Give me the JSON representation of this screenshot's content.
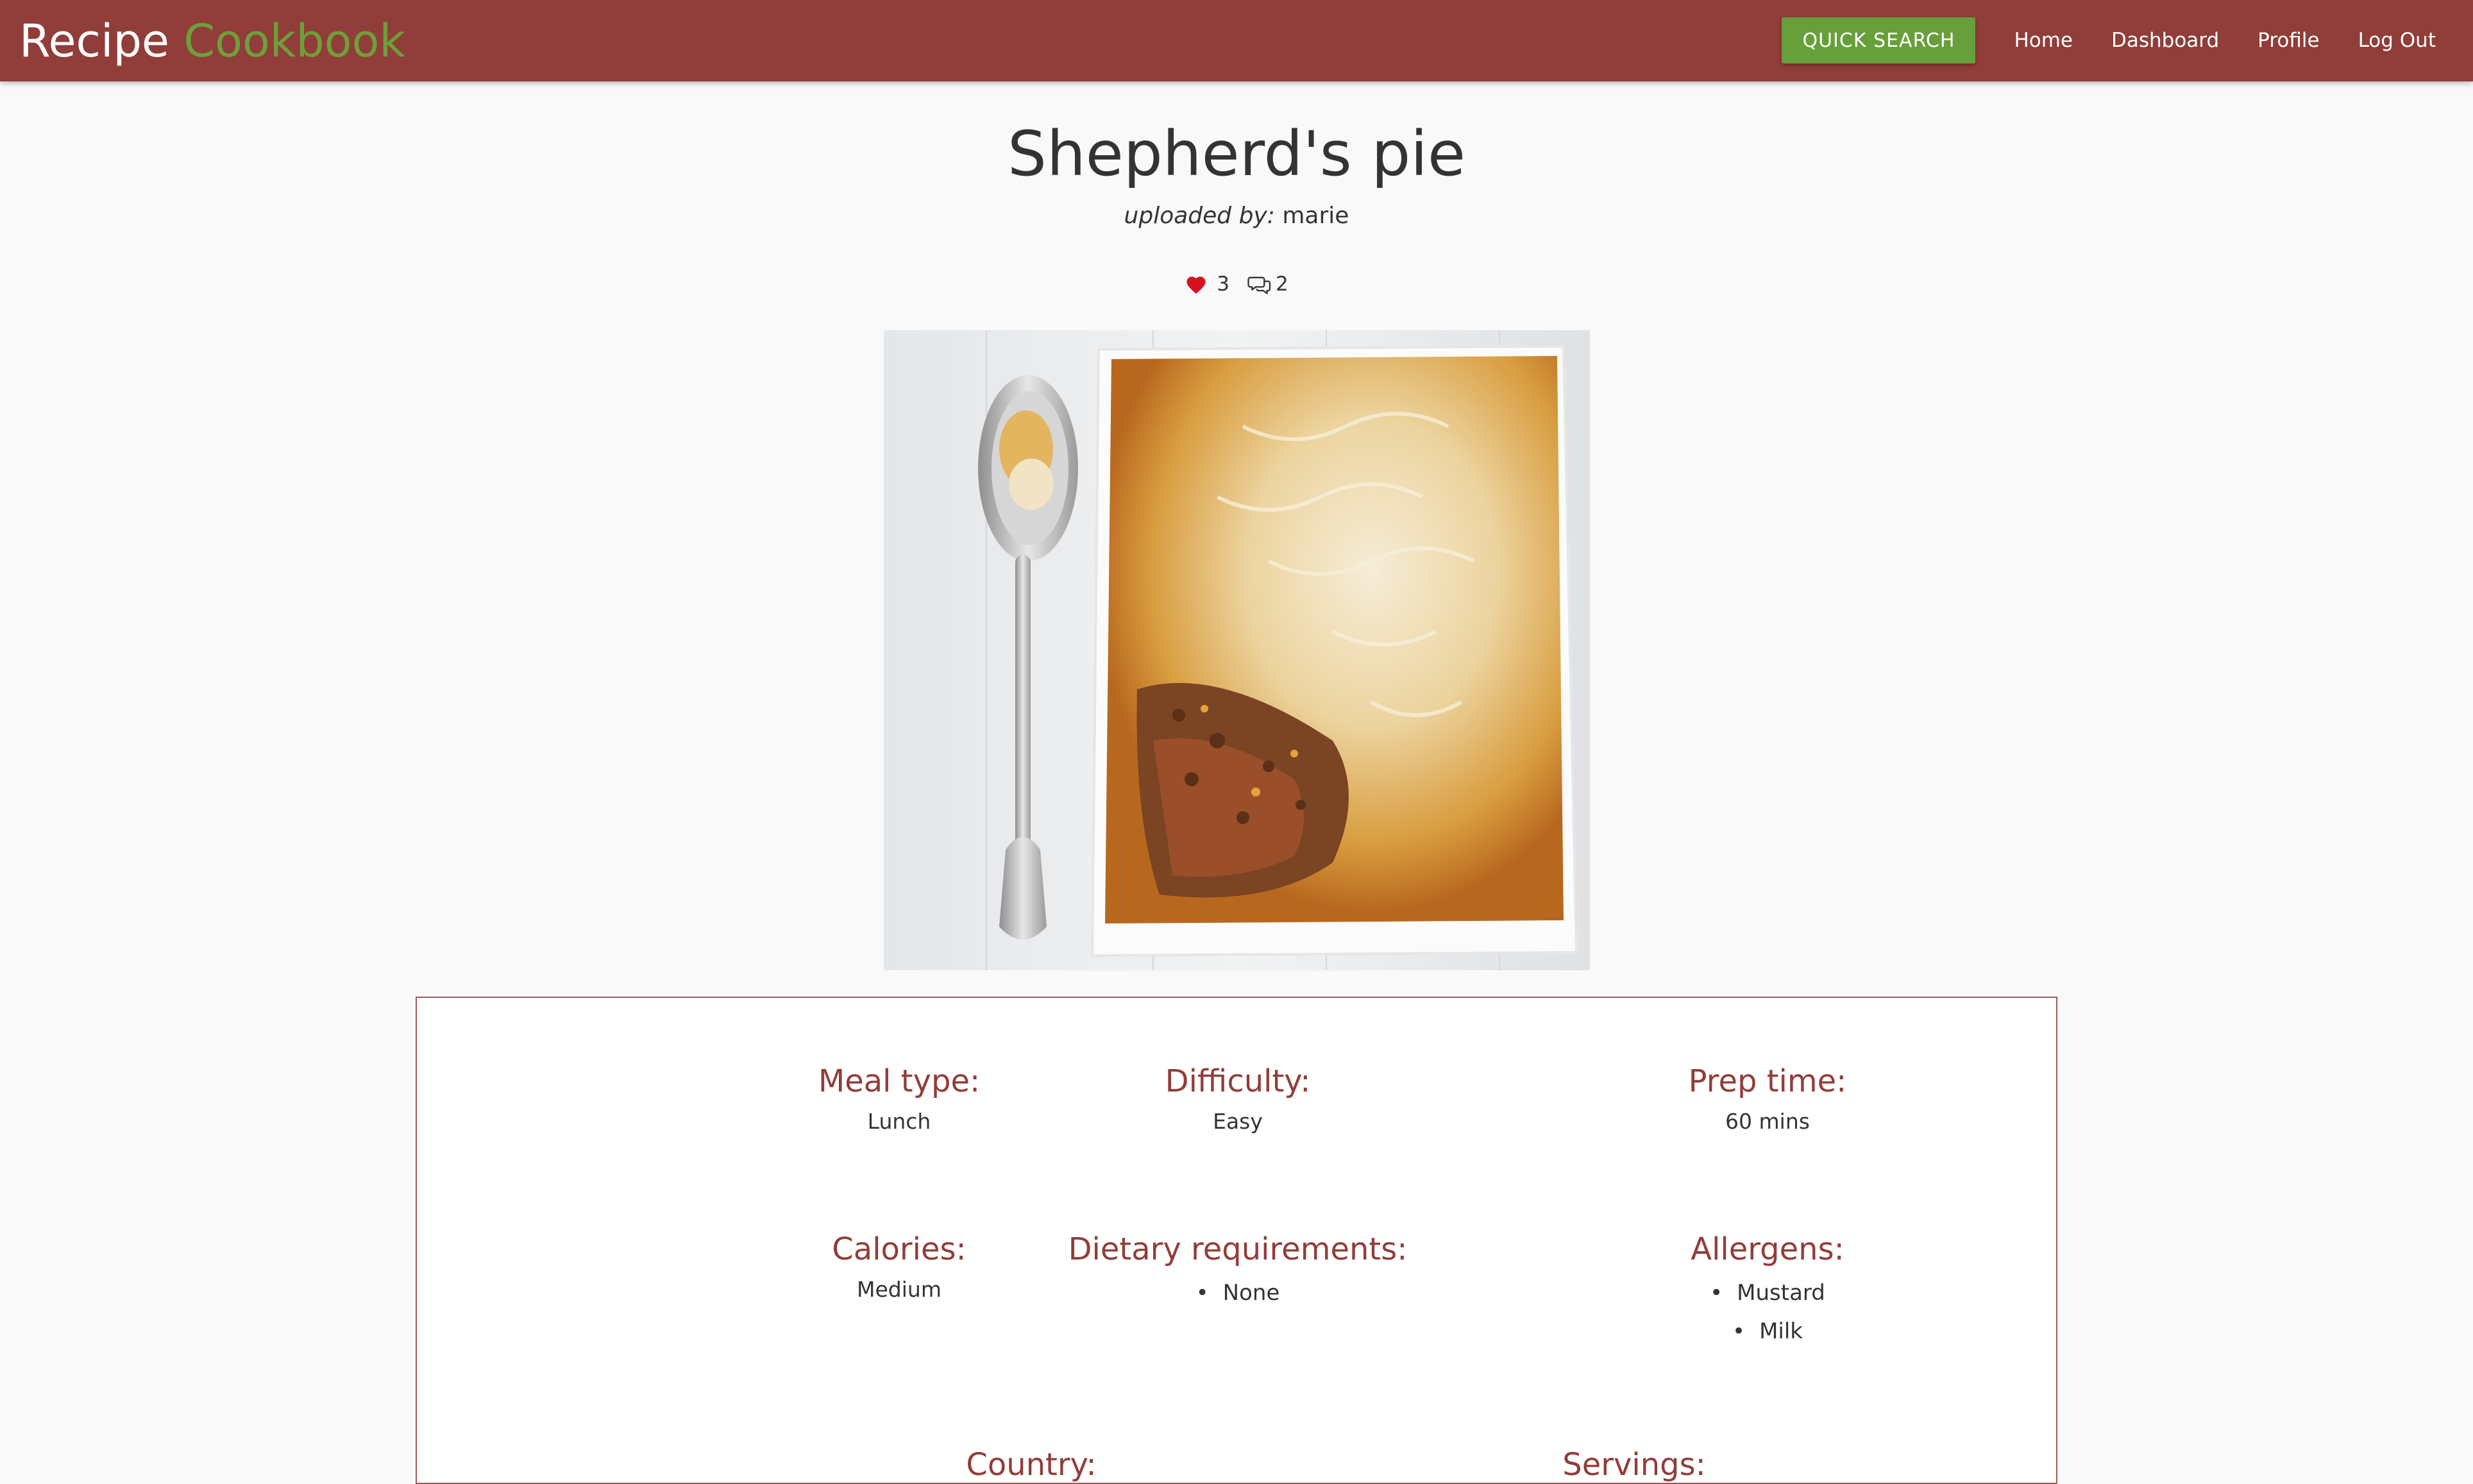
{
  "navbar": {
    "brand_part1": "Recipe",
    "brand_part2": "Cookbook",
    "quick_search": "QUICK SEARCH",
    "links": [
      "Home",
      "Dashboard",
      "Profile",
      "Log Out"
    ],
    "bg_color": "#913d39",
    "accent_color": "#6ea03a"
  },
  "recipe": {
    "title": "Shepherd's pie",
    "uploaded_by_label": "uploaded by:",
    "uploader": "marie",
    "likes": "3",
    "comments": "2",
    "image_alt": "Shepherd's pie in a baking dish with a spoon"
  },
  "details": {
    "meal_type_label": "Meal type:",
    "meal_type": "Lunch",
    "difficulty_label": "Difficulty:",
    "difficulty": "Easy",
    "prep_time_label": "Prep time:",
    "prep_time": "60 mins",
    "calories_label": "Calories:",
    "calories": "Medium",
    "dietary_label": "Dietary requirements:",
    "dietary": [
      "None"
    ],
    "allergens_label": "Allergens:",
    "allergens": [
      "Mustard",
      "Milk"
    ],
    "country_label": "Country:",
    "servings_label": "Servings:"
  }
}
